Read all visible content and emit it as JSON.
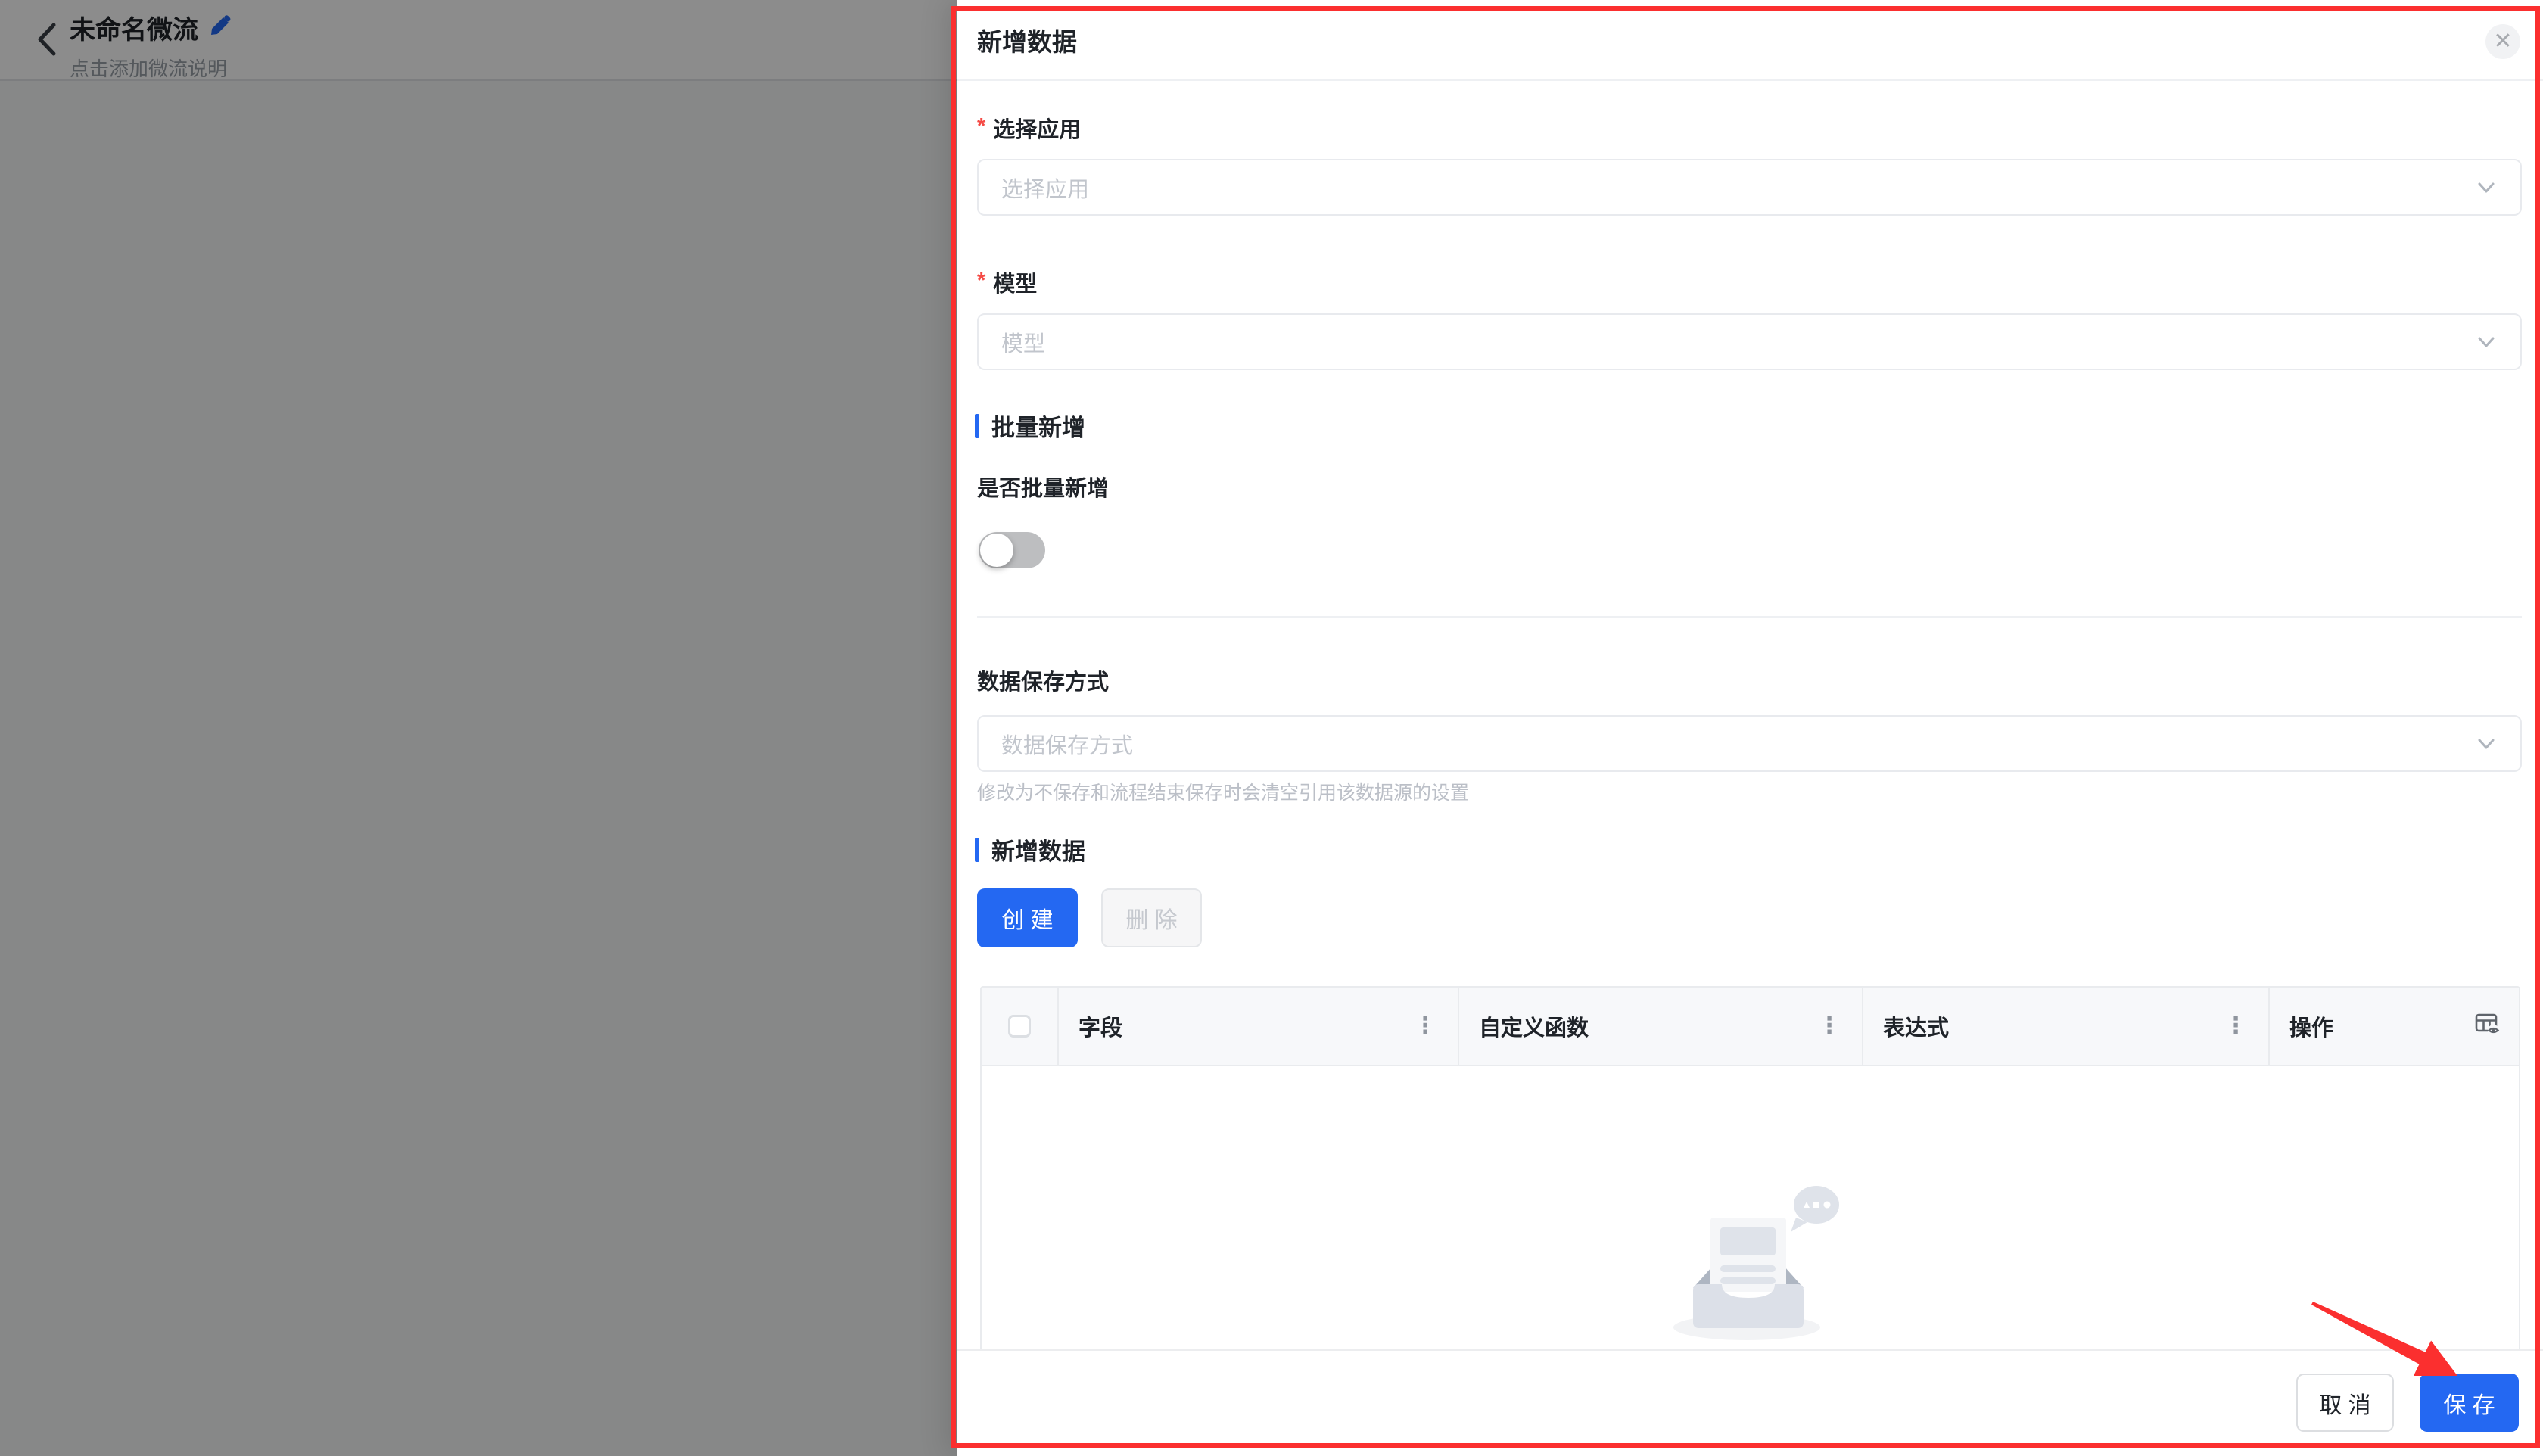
{
  "page": {
    "title": "未命名微流",
    "subtitle": "点击添加微流说明"
  },
  "modal": {
    "title": "新增数据",
    "close_glyph": "✕",
    "required_mark": "*",
    "fields": {
      "app": {
        "label": "选择应用",
        "placeholder": "选择应用"
      },
      "model": {
        "label": "模型",
        "placeholder": "模型"
      },
      "save_mode": {
        "label": "数据保存方式",
        "placeholder": "数据保存方式",
        "helper": "修改为不保存和流程结束保存时会清空引用该数据源的设置"
      }
    },
    "sections": {
      "batch": "批量新增",
      "add_data": "新增数据"
    },
    "batch_toggle_label": "是否批量新增",
    "toggle_state": "off",
    "toolbar": {
      "create": "创 建",
      "delete": "删 除"
    },
    "table": {
      "kebab_glyph": "⋮",
      "columns": [
        {
          "label": "字段"
        },
        {
          "label": "自定义函数"
        },
        {
          "label": "表达式"
        },
        {
          "label": "操作"
        }
      ],
      "rows": []
    },
    "footer": {
      "cancel": "取 消",
      "save": "保 存"
    }
  },
  "colors": {
    "accent_blue": "#2468F2",
    "annotation_red": "#FB2F2F",
    "required_red": "#F54A45"
  }
}
